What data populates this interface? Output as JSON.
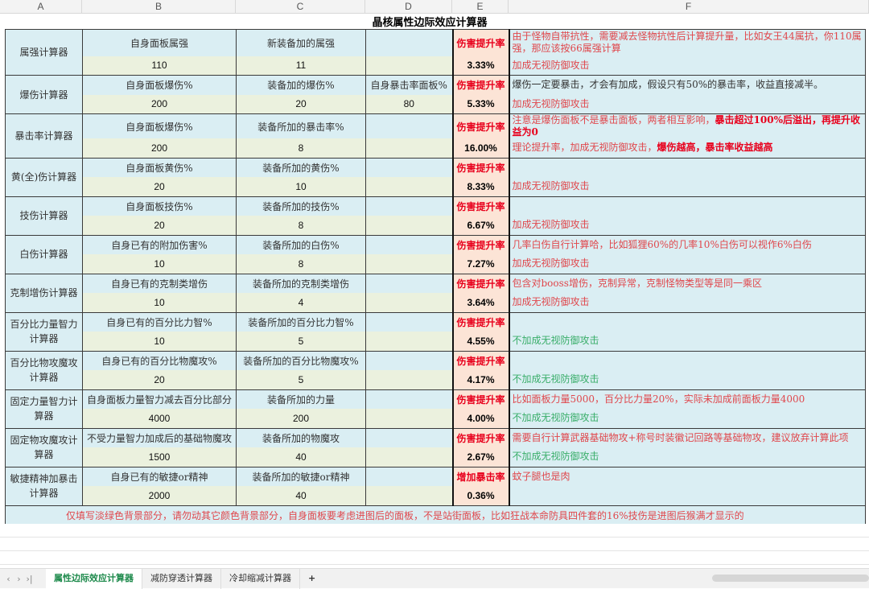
{
  "columns": [
    "A",
    "B",
    "C",
    "D",
    "E",
    "F"
  ],
  "title": "晶核属性边际效应计算器",
  "blocks": [
    {
      "name": "属强计算器",
      "b_label": "自身面板属强",
      "c_label": "新装备加的属强",
      "d_label": "",
      "e_label": "伤害提升率",
      "b_val": "110",
      "c_val": "11",
      "d_val": "",
      "e_val": "3.33%",
      "note1": [
        {
          "t": "由于怪物自带抗性，需要减去怪物抗性后计算提升量，比如女王44属抗，你110属强，那应该按66属强计算",
          "s": ""
        }
      ],
      "note2": [
        {
          "t": "加成无视防御攻击",
          "s": ""
        }
      ]
    },
    {
      "name": "爆伤计算器",
      "b_label": "自身面板爆伤%",
      "c_label": "装备加的爆伤%",
      "d_label": "自身暴击率面板%",
      "e_label": "伤害提升率",
      "b_val": "200",
      "c_val": "20",
      "d_val": "80",
      "e_val": "5.33%",
      "note1": [
        {
          "t": "爆伤一定要暴击，才会有加成，假设只有50%的暴击率，收益直接减半。",
          "s": "k"
        }
      ],
      "note2": [
        {
          "t": "加成无视防御攻击",
          "s": ""
        }
      ]
    },
    {
      "name": "暴击率计算器",
      "b_label": "自身面板爆伤%",
      "c_label": "装备所加的暴击率%",
      "d_label": "",
      "e_label": "伤害提升率",
      "b_val": "200",
      "c_val": "8",
      "d_val": "",
      "e_val": "16.00%",
      "note1": [
        {
          "t": "注意是爆伤面板不是暴击面板，两者相互影响，",
          "s": ""
        },
        {
          "t": "暴击超过100%后溢出，再提升收益为0",
          "s": "b"
        }
      ],
      "note2": [
        {
          "t": "理论提升率，加成无视防御攻击，",
          "s": ""
        },
        {
          "t": "爆伤越高，暴击率收益越高",
          "s": "b"
        }
      ]
    },
    {
      "name": "黄(全)伤计算器",
      "b_label": "自身面板黄伤%",
      "c_label": "装备所加的黄伤%",
      "d_label": "",
      "e_label": "伤害提升率",
      "b_val": "20",
      "c_val": "10",
      "d_val": "",
      "e_val": "8.33%",
      "note1": [],
      "note2": [
        {
          "t": "加成无视防御攻击",
          "s": ""
        }
      ]
    },
    {
      "name": "技伤计算器",
      "b_label": "自身面板技伤%",
      "c_label": "装备所加的技伤%",
      "d_label": "",
      "e_label": "伤害提升率",
      "b_val": "20",
      "c_val": "8",
      "d_val": "",
      "e_val": "6.67%",
      "note1": [],
      "note2": [
        {
          "t": "加成无视防御攻击",
          "s": ""
        }
      ]
    },
    {
      "name": "白伤计算器",
      "b_label": "自身已有的附加伤害%",
      "c_label": "装备所加的白伤%",
      "d_label": "",
      "e_label": "伤害提升率",
      "b_val": "10",
      "c_val": "8",
      "d_val": "",
      "e_val": "7.27%",
      "note1": [
        {
          "t": "几率白伤自行计算哈，比如狐狸60%的几率10%白伤可以视作6%白伤",
          "s": ""
        }
      ],
      "note2": [
        {
          "t": "加成无视防御攻击",
          "s": ""
        }
      ]
    },
    {
      "name": "克制增伤计算器",
      "b_label": "自身已有的克制类增伤",
      "c_label": "装备所加的克制类增伤",
      "d_label": "",
      "e_label": "伤害提升率",
      "b_val": "10",
      "c_val": "4",
      "d_val": "",
      "e_val": "3.64%",
      "note1": [
        {
          "t": "包含对booss增伤，克制异常，克制怪物类型等是同一乘区",
          "s": ""
        }
      ],
      "note2": [
        {
          "t": "加成无视防御攻击",
          "s": ""
        }
      ]
    },
    {
      "name": "百分比力量智力计算器",
      "b_label": "自身已有的百分比力智%",
      "c_label": "装备所加的百分比力智%",
      "d_label": "",
      "e_label": "伤害提升率",
      "b_val": "10",
      "c_val": "5",
      "d_val": "",
      "e_val": "4.55%",
      "note1": [],
      "note2": [
        {
          "t": "不加成无视防御攻击",
          "s": "g"
        }
      ]
    },
    {
      "name": "百分比物攻魔攻计算器",
      "b_label": "自身已有的百分比物魔攻%",
      "c_label": "装备所加的百分比物魔攻%",
      "d_label": "",
      "e_label": "伤害提升率",
      "b_val": "20",
      "c_val": "5",
      "d_val": "",
      "e_val": "4.17%",
      "note1": [],
      "note2": [
        {
          "t": "不加成无视防御攻击",
          "s": "g"
        }
      ]
    },
    {
      "name": "固定力量智力计算器",
      "b_label": "自身面板力量智力减去百分比部分",
      "c_label": "装备所加的力量",
      "d_label": "",
      "e_label": "伤害提升率",
      "b_val": "4000",
      "c_val": "200",
      "d_val": "",
      "e_val": "4.00%",
      "note1": [
        {
          "t": "比如面板力量5000，百分比力量20%，实际未加成前面板力量4000",
          "s": ""
        }
      ],
      "note2": [
        {
          "t": "不加成无视防御攻击",
          "s": "g"
        }
      ]
    },
    {
      "name": "固定物攻魔攻计算器",
      "b_label": "不受力量智力加成后的基础物魔攻",
      "c_label": "装备所加的物魔攻",
      "d_label": "",
      "e_label": "伤害提升率",
      "b_val": "1500",
      "c_val": "40",
      "d_val": "",
      "e_val": "2.67%",
      "note1": [
        {
          "t": "需要自行计算武器基础物攻+称号时装徽记回路等基础物攻，建议放弃计算此项",
          "s": ""
        }
      ],
      "note2": [
        {
          "t": "不加成无视防御攻击",
          "s": "g"
        }
      ]
    },
    {
      "name": "敏捷精神加暴击计算器",
      "b_label": "自身已有的敏捷or精神",
      "c_label": "装备所加的敏捷or精神",
      "d_label": "",
      "e_label": "增加暴击率",
      "b_val": "2000",
      "c_val": "40",
      "d_val": "",
      "e_val": "0.36%",
      "note1": [
        {
          "t": "蚊子腿也是肉",
          "s": ""
        }
      ],
      "note2": []
    }
  ],
  "footer": "仅填写淡绿色背景部分，请勿动其它颜色背景部分，自身面板要考虑进图后的面板，不是站街面板，比如狂战本命防具四件套的16%技伤是进图后猴满才显示的",
  "tabs": [
    "属性边际效应计算器",
    "减防穿透计算器",
    "冷却缩减计算器"
  ],
  "active_tab": "属性边际效应计算器",
  "add_tab": "+"
}
